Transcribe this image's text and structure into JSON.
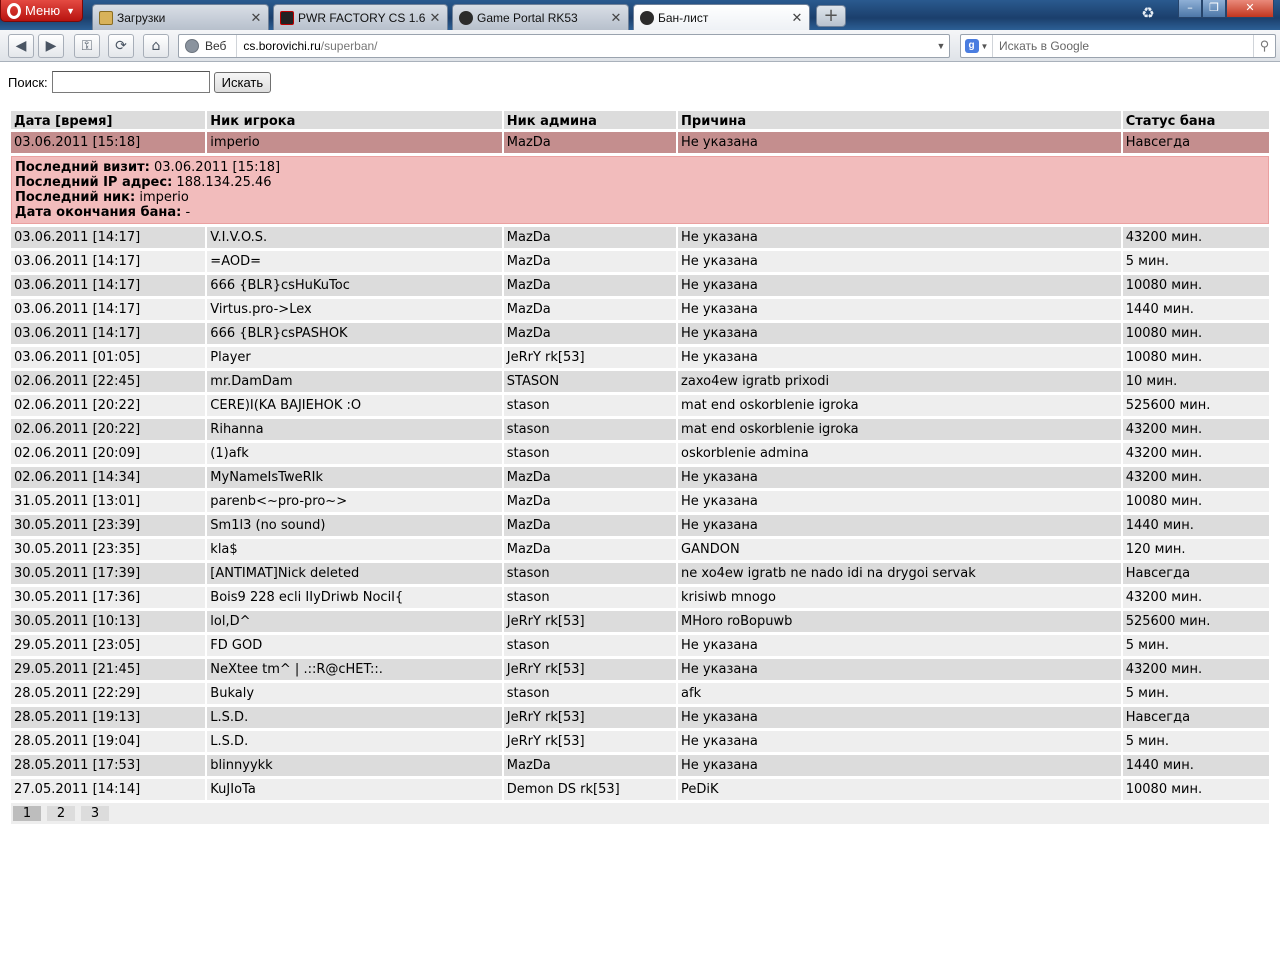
{
  "browser": {
    "menu_label": "Меню",
    "tabs": [
      {
        "title": "Загрузки"
      },
      {
        "title": "PWR FACTORY CS 1.6 ..."
      },
      {
        "title": "Game Portal RK53"
      },
      {
        "title": "Бан-лист"
      }
    ],
    "address": {
      "mode_label": "Веб",
      "url_host": "cs.borovichi.ru",
      "url_path": "/superban/"
    },
    "search_placeholder": "Искать в Google"
  },
  "page": {
    "search_label": "Поиск:",
    "search_value": "",
    "search_button": "Искать",
    "headers": [
      "Дата [время]",
      "Ник игрока",
      "Ник админа",
      "Причина",
      "Статус бана"
    ],
    "selected_row": {
      "date": "03.06.2011 [15:18]",
      "player": "imperio",
      "admin": "MazDa",
      "reason": "Не указана",
      "status": "Навсегда"
    },
    "details": {
      "visit_label": "Последний визит:",
      "visit_value": "03.06.2011 [15:18]",
      "ip_label": "Последний IP адрес:",
      "ip_value": "188.134.25.46",
      "nick_label": "Последний ник:",
      "nick_value": "imperio",
      "end_label": "Дата окончания бана:",
      "end_value": "-"
    },
    "rows": [
      {
        "date": "03.06.2011 [14:17]",
        "player": "V.I.V.O.S.",
        "admin": "MazDa",
        "reason": "Не указана",
        "status": "43200 мин."
      },
      {
        "date": "03.06.2011 [14:17]",
        "player": "=AOD=",
        "admin": "MazDa",
        "reason": "Не указана",
        "status": "5 мин."
      },
      {
        "date": "03.06.2011 [14:17]",
        "player": "666 {BLR}csHuKuToc",
        "admin": "MazDa",
        "reason": "Не указана",
        "status": "10080 мин."
      },
      {
        "date": "03.06.2011 [14:17]",
        "player": "Virtus.pro->Lex",
        "admin": "MazDa",
        "reason": "Не указана",
        "status": "1440 мин."
      },
      {
        "date": "03.06.2011 [14:17]",
        "player": "666 {BLR}csPASHOK",
        "admin": "MazDa",
        "reason": "Не указана",
        "status": "10080 мин."
      },
      {
        "date": "03.06.2011 [01:05]",
        "player": "Player",
        "admin": "JeRrY rk[53]",
        "reason": "Не указана",
        "status": "10080 мин."
      },
      {
        "date": "02.06.2011 [22:45]",
        "player": "mr.DamDam",
        "admin": "STASON",
        "reason": "zaxo4ew igratb prixodi",
        "status": "10 мин."
      },
      {
        "date": "02.06.2011 [20:22]",
        "player": "CERE)I(KA BAJIEHOK :O",
        "admin": "stason",
        "reason": "mat end oskorblenie igroka",
        "status": "525600 мин."
      },
      {
        "date": "02.06.2011 [20:22]",
        "player": "Rihanna",
        "admin": "stason",
        "reason": "mat end oskorblenie igroka",
        "status": "43200 мин."
      },
      {
        "date": "02.06.2011 [20:09]",
        "player": "(1)afk",
        "admin": "stason",
        "reason": "oskorblenie admina",
        "status": "43200 мин."
      },
      {
        "date": "02.06.2011 [14:34]",
        "player": "MyNameIsTweRIk",
        "admin": "MazDa",
        "reason": "Не указана",
        "status": "43200 мин."
      },
      {
        "date": "31.05.2011 [13:01]",
        "player": "parenb<~pro-pro~>",
        "admin": "MazDa",
        "reason": "Не указана",
        "status": "10080 мин."
      },
      {
        "date": "30.05.2011 [23:39]",
        "player": "Sm1l3 (no sound)",
        "admin": "MazDa",
        "reason": "Не указана",
        "status": "1440 мин."
      },
      {
        "date": "30.05.2011 [23:35]",
        "player": "kla$",
        "admin": "MazDa",
        "reason": "GANDON",
        "status": "120 мин."
      },
      {
        "date": "30.05.2011 [17:39]",
        "player": "[ANTIMAT]Nick deleted",
        "admin": "stason",
        "reason": "ne xo4ew igratb ne nado idi na drygoi servak",
        "status": "Навсегда"
      },
      {
        "date": "30.05.2011 [17:36]",
        "player": "Bois9 228 ecli IIyDriwb NociI{",
        "admin": "stason",
        "reason": "krisiwb mnogo",
        "status": "43200 мин."
      },
      {
        "date": "30.05.2011 [10:13]",
        "player": "lol,D^",
        "admin": "JeRrY rk[53]",
        "reason": "MHoro roBopuwb",
        "status": "525600 мин."
      },
      {
        "date": "29.05.2011 [23:05]",
        "player": "FD GOD",
        "admin": "stason",
        "reason": "Не указана",
        "status": "5 мин."
      },
      {
        "date": "29.05.2011 [21:45]",
        "player": "NeXtee tm^ | .::R@cHET::.",
        "admin": "JeRrY rk[53]",
        "reason": "Не указана",
        "status": "43200 мин."
      },
      {
        "date": "28.05.2011 [22:29]",
        "player": "Bukaly",
        "admin": "stason",
        "reason": "afk",
        "status": "5 мин."
      },
      {
        "date": "28.05.2011 [19:13]",
        "player": "L.S.D.",
        "admin": "JeRrY rk[53]",
        "reason": "Не указана",
        "status": "Навсегда"
      },
      {
        "date": "28.05.2011 [19:04]",
        "player": "L.S.D.",
        "admin": "JeRrY rk[53]",
        "reason": "Не указана",
        "status": "5 мин."
      },
      {
        "date": "28.05.2011 [17:53]",
        "player": "blinnyykk",
        "admin": "MazDa",
        "reason": "Не указана",
        "status": "1440 мин."
      },
      {
        "date": "27.05.2011 [14:14]",
        "player": "KuJIoTa",
        "admin": "Demon DS rk[53]",
        "reason": "PeDiK",
        "status": "10080 мин."
      }
    ],
    "pages": [
      "1",
      "2",
      "3"
    ],
    "current_page": "1"
  }
}
